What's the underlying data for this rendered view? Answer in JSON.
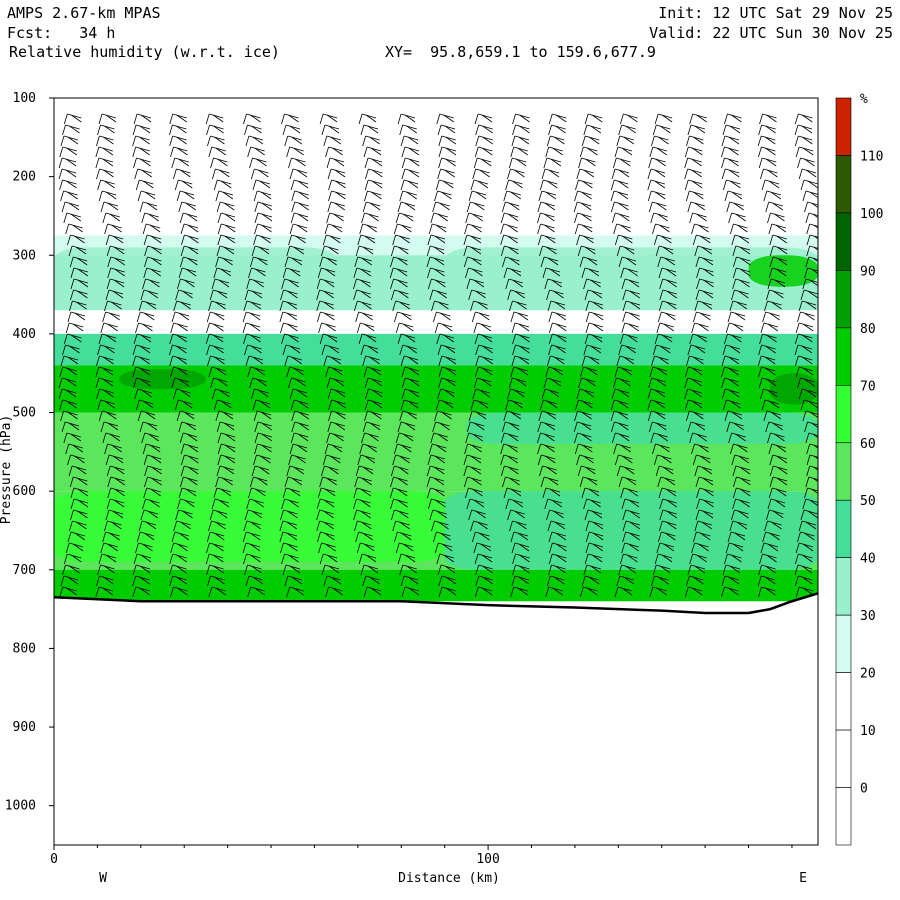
{
  "header": {
    "model": "AMPS 2.67-km MPAS",
    "forecast": "Fcst:   34 h",
    "field": "Relative humidity (w.r.t. ice)",
    "xy": "XY=  95.8,659.1 to 159.6,677.9",
    "init": "Init: 12 UTC Sat 29 Nov 25",
    "valid": "Valid: 22 UTC Sun 30 Nov 25"
  },
  "chart_data": {
    "type": "heatmap",
    "xlabel": "Distance (km)",
    "ylabel": "Pressure (hPa)",
    "xlim": [
      0,
      176
    ],
    "ylim": [
      1050,
      100
    ],
    "x_ticks": [
      "0",
      "100"
    ],
    "x_tick_values": [
      0,
      100
    ],
    "y_ticks": [
      "100",
      "200",
      "300",
      "400",
      "500",
      "600",
      "700",
      "800",
      "900",
      "1000"
    ],
    "y_tick_values": [
      100,
      200,
      300,
      400,
      500,
      600,
      700,
      800,
      900,
      1000
    ],
    "west_label": "W",
    "east_label": "E",
    "colorbar": {
      "unit": "%",
      "levels": [
        "110",
        "100",
        "90",
        "80",
        "70",
        "60",
        "50",
        "40",
        "30",
        "20",
        "10",
        "0"
      ],
      "level_values": [
        110,
        100,
        90,
        80,
        70,
        60,
        50,
        40,
        30,
        20,
        10,
        0
      ],
      "colors": [
        "#cc2200",
        "#2d5a00",
        "#006400",
        "#00a000",
        "#00cc00",
        "#33ff33",
        "#5ce65c",
        "#44dd99",
        "#99f0cc",
        "#d4fbef",
        "#ffffff",
        "#ffffff",
        "#ffffff"
      ]
    },
    "rh_layers": [
      {
        "p_top": 100,
        "p_bottom": 275,
        "rh": 10
      },
      {
        "p_top": 275,
        "p_bottom": 300,
        "rh": 30
      },
      {
        "p_top": 300,
        "p_bottom": 370,
        "rh": 40
      },
      {
        "p_top": 370,
        "p_bottom": 400,
        "rh": 20
      },
      {
        "p_top": 400,
        "p_bottom": 440,
        "rh": 50
      },
      {
        "p_top": 440,
        "p_bottom": 500,
        "rh": 80
      },
      {
        "p_top": 500,
        "p_bottom": 600,
        "rh": 60
      },
      {
        "p_top": 600,
        "p_bottom": 700,
        "rh": 60
      },
      {
        "p_top": 700,
        "p_bottom": 740,
        "rh": 80
      }
    ],
    "rh_patches": [
      {
        "x": [
          15,
          35
        ],
        "p": [
          445,
          470
        ],
        "rh": 90
      },
      {
        "x": [
          90,
          176
        ],
        "p": [
          290,
          360
        ],
        "rh": 40
      },
      {
        "x": [
          0,
          65
        ],
        "p": [
          290,
          330
        ],
        "rh": 40
      },
      {
        "x": [
          95,
          176
        ],
        "p": [
          500,
          540
        ],
        "rh": 50
      },
      {
        "x": [
          90,
          176
        ],
        "p": [
          600,
          700
        ],
        "rh": 50
      },
      {
        "x": [
          0,
          90
        ],
        "p": [
          600,
          690
        ],
        "rh": 70
      },
      {
        "x": [
          165,
          176
        ],
        "p": [
          450,
          490
        ],
        "rh": 90
      },
      {
        "x": [
          160,
          176
        ],
        "p": [
          300,
          340
        ],
        "rh": 80
      }
    ],
    "terrain": {
      "x": [
        0,
        20,
        40,
        60,
        80,
        100,
        120,
        140,
        150,
        160,
        165,
        170,
        176
      ],
      "p": [
        735,
        740,
        740,
        740,
        740,
        745,
        748,
        752,
        755,
        755,
        750,
        740,
        730
      ]
    },
    "wind_barb_columns": 21
  }
}
